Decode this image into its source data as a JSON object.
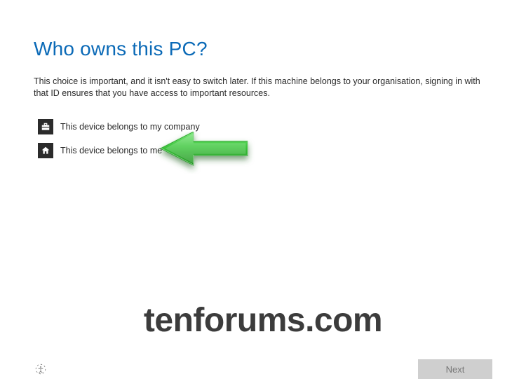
{
  "heading": "Who owns this PC?",
  "description": "This choice is important, and it isn't easy to switch later. If this machine belongs to your organisation, signing in with that ID ensures that you have access to important resources.",
  "options": {
    "company": "This device belongs to my company",
    "personal": "This device belongs to me"
  },
  "watermark": "tenforums.com",
  "buttons": {
    "next": "Next"
  },
  "colors": {
    "accent": "#0b6ab7",
    "arrow": "#3cc63c"
  }
}
